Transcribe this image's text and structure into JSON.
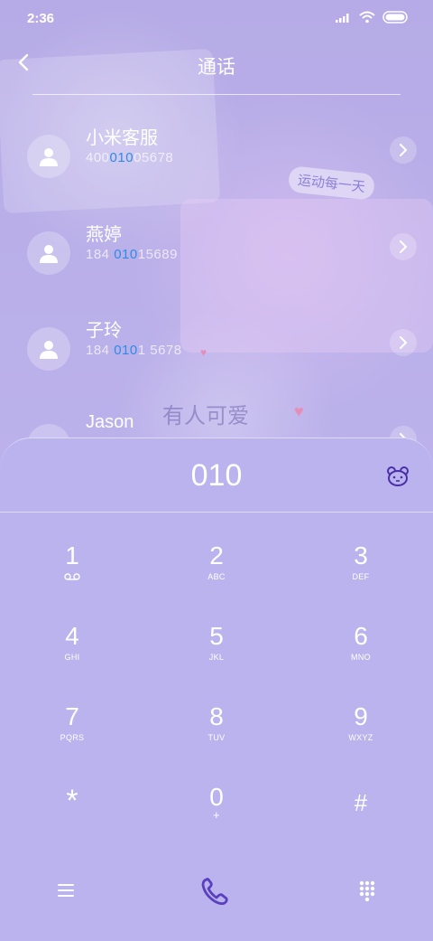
{
  "status_bar": {
    "time": "2:36"
  },
  "header": {
    "title": "通话"
  },
  "contacts": [
    {
      "name": "小米客服",
      "num_pre": "400",
      "num_match": "010",
      "num_post": "05678"
    },
    {
      "name": "燕婷",
      "num_pre": "184 ",
      "num_match": "010",
      "num_post": "15689"
    },
    {
      "name": "子玲",
      "num_pre": "184 ",
      "num_match": "010",
      "num_post": "1 5678"
    },
    {
      "name": "Jason",
      "num_pre": "",
      "num_match": "",
      "num_post": ""
    }
  ],
  "dialpad": {
    "input": "010",
    "keys": [
      {
        "digit": "1",
        "letters": ""
      },
      {
        "digit": "2",
        "letters": "ABC"
      },
      {
        "digit": "3",
        "letters": "DEF"
      },
      {
        "digit": "4",
        "letters": "GHI"
      },
      {
        "digit": "5",
        "letters": "JKL"
      },
      {
        "digit": "6",
        "letters": "MNO"
      },
      {
        "digit": "7",
        "letters": "PQRS"
      },
      {
        "digit": "8",
        "letters": "TUV"
      },
      {
        "digit": "9",
        "letters": "WXYZ"
      },
      {
        "digit": "*",
        "letters": ""
      },
      {
        "digit": "0",
        "letters": "+"
      },
      {
        "digit": "#",
        "letters": ""
      }
    ]
  },
  "wallpaper": {
    "sticker_texts": [
      "运动每一天",
      "有人可爱"
    ]
  },
  "icons": {
    "back": "back-arrow-icon",
    "call": "phone-icon",
    "menu": "menu-icon",
    "keypad": "keypad-grid-icon",
    "voicemail": "voicemail-icon"
  },
  "colors": {
    "match_highlight": "#2f8be6",
    "accent_purple": "#5a3fbf"
  }
}
